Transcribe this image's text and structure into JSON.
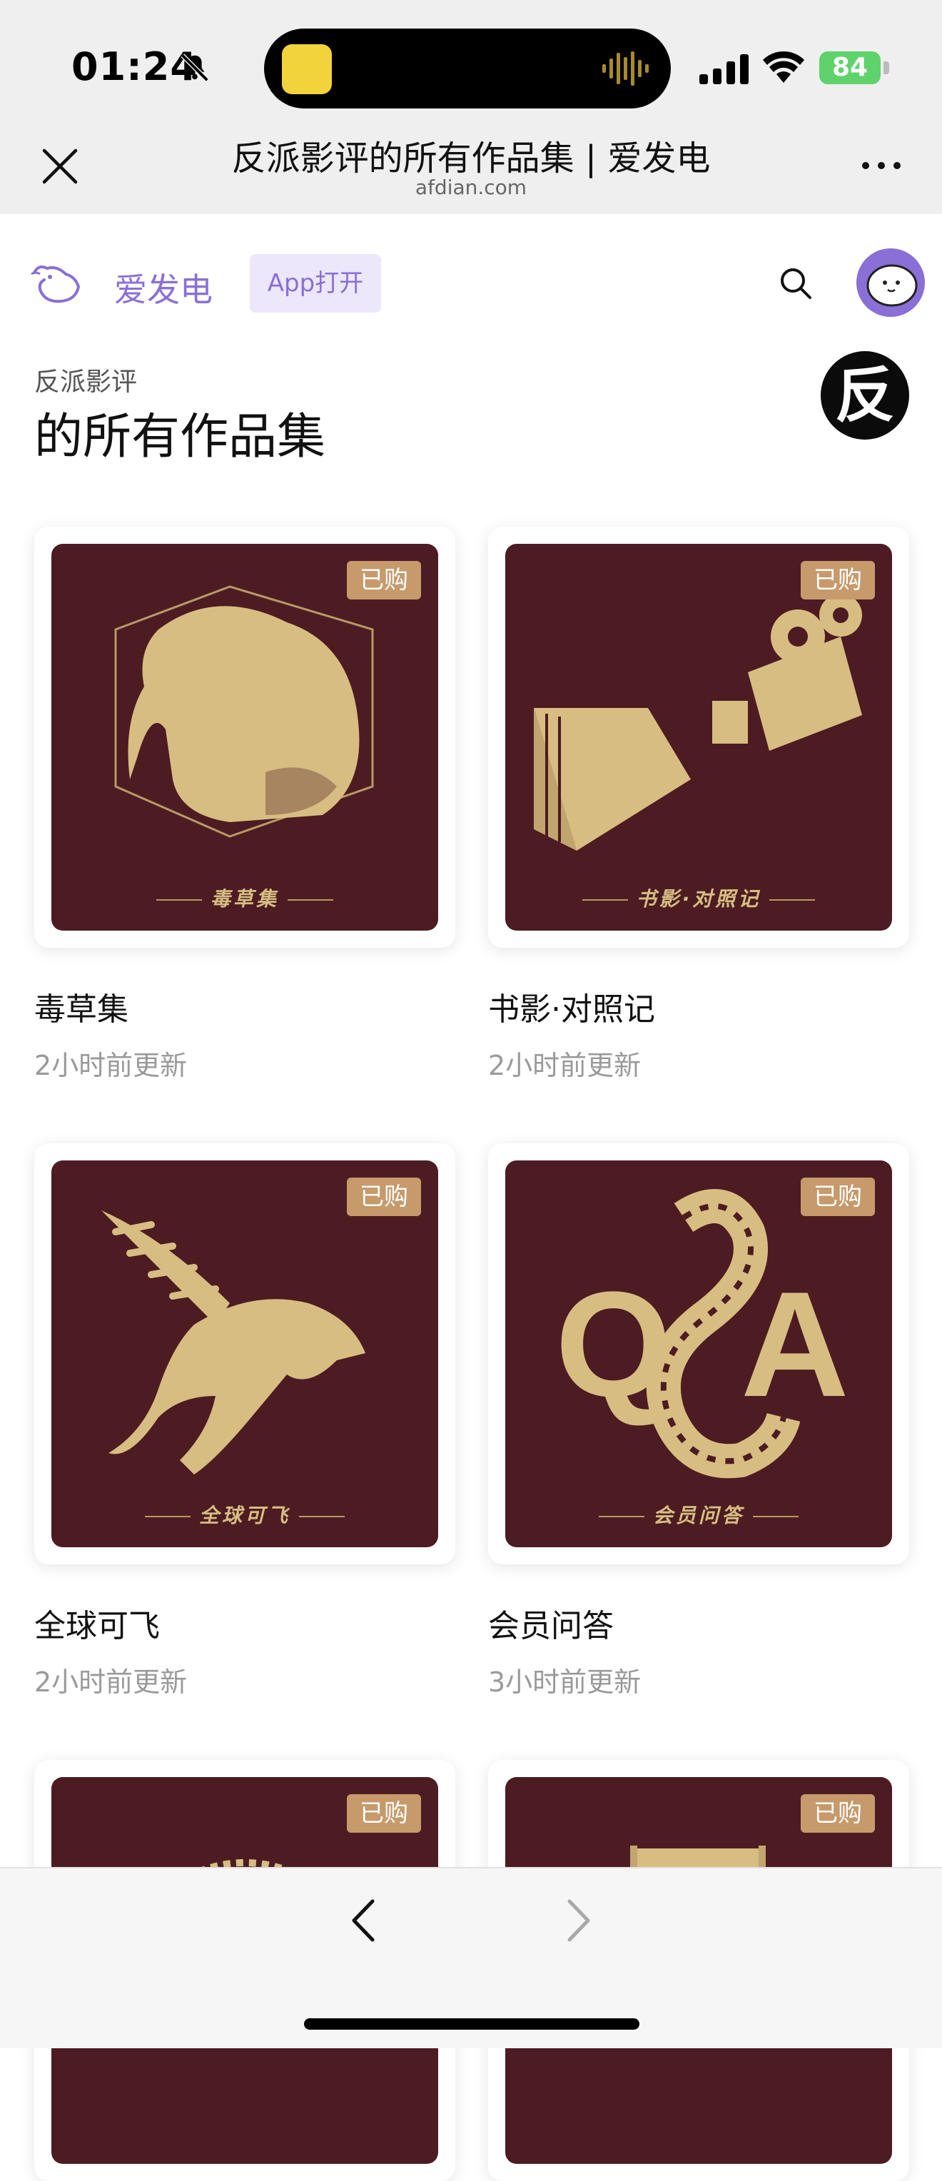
{
  "status": {
    "time": "01:24",
    "battery": "84"
  },
  "browser": {
    "title": "反派影评的所有作品集 | 爱发电",
    "domain": "afdian.com"
  },
  "nav": {
    "brand": "爱发电",
    "app_open": "App打开"
  },
  "heading": {
    "author": "反派影评",
    "title": "的所有作品集",
    "author_avatar_char": "反"
  },
  "cards": [
    {
      "title": "毒草集",
      "updated": "2小时前更新",
      "badge": "已购",
      "cover_caption": "毒草集"
    },
    {
      "title": "书影·对照记",
      "updated": "2小时前更新",
      "badge": "已购",
      "cover_caption": "书影·对照记"
    },
    {
      "title": "全球可飞",
      "updated": "2小时前更新",
      "badge": "已购",
      "cover_caption": "全球可飞"
    },
    {
      "title": "会员问答",
      "updated": "3小时前更新",
      "badge": "已购",
      "cover_caption": "会员问答"
    },
    {
      "badge": "已购"
    },
    {
      "badge": "已购"
    }
  ],
  "colors": {
    "accent": "#8a6fd6",
    "cover_bg": "#4c1c22",
    "cover_gold": "#d8bd82",
    "badge": "#c79a6b"
  }
}
